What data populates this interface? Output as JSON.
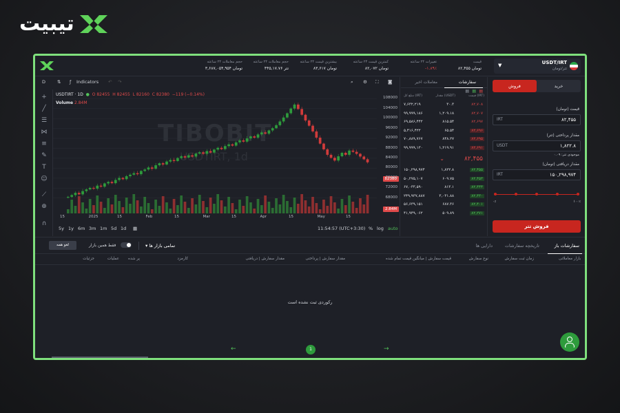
{
  "brand": {
    "name": "تیبیت"
  },
  "ticker": {
    "pair": "USDT/IRT",
    "pair_sub": "تتر/تومان",
    "stats": [
      {
        "label": "قیمت",
        "value": "۸۲,۴۵۵ تومان"
      },
      {
        "label": "تغییرات ۲۴ ساعته",
        "value": "-۱.۸۹٪"
      },
      {
        "label": "کمترین قیمت ۲۴ ساعته",
        "value": "۸۲,۰۷۲ تومان"
      },
      {
        "label": "بیشترین قیمت ۲۴ ساعته",
        "value": "۸۳,۶۱۷ تومان"
      },
      {
        "label": "حجم معاملات ۲۴ ساعته",
        "value": "۴۴۵,۱۷.۷۶ تتر"
      },
      {
        "label": "حجم معاملات ۲۴ ساعته",
        "value": "۳,۶۸۷,۰۵۴,۹۵۴ تومان"
      }
    ]
  },
  "chart": {
    "interval": "D",
    "indicators_label": "Indicators",
    "symbol_title": "USDTIRT · 1D",
    "ohlc": {
      "o": "O 82455",
      "h": "H 82455",
      "l": "L 82160",
      "c": "C 82380",
      "chg": "−119 (−0.14%)"
    },
    "volume_label": "Volume",
    "volume_value": "2.84M",
    "watermark": "TIBOBIT",
    "watermark_sub": "USDTIRT, 1d",
    "last_price_tag": "82380",
    "volume_tag": "2.84M",
    "ranges": [
      "5y",
      "1y",
      "6m",
      "3m",
      "1m",
      "5d",
      "1d"
    ],
    "clock": "11:54:57 (UTC+3:30)",
    "log_label": "log",
    "auto_label": "auto",
    "pct_label": "%"
  },
  "chart_data": {
    "type": "candlestick",
    "y_ticks": [
      108000,
      104000,
      100000,
      96000,
      92000,
      88000,
      84000,
      80000,
      76000,
      72000,
      68000
    ],
    "x_ticks": [
      "15",
      "2025",
      "15",
      "Feb",
      "15",
      "Mar",
      "15",
      "Apr",
      "15",
      "May",
      "15"
    ],
    "ylim": [
      66000,
      110000
    ],
    "closes": [
      68500,
      69200,
      70100,
      69500,
      70800,
      71500,
      72100,
      71800,
      73000,
      72600,
      73900,
      74500,
      74000,
      75300,
      76100,
      75600,
      76800,
      77400,
      78000,
      77600,
      78900,
      79500,
      80300,
      79800,
      81200,
      82000,
      81500,
      82700,
      83300,
      82900,
      84100,
      84800,
      84300,
      85200,
      84700,
      85900,
      86400,
      85800,
      86900,
      86300,
      87500,
      88200,
      87700,
      88900,
      89600,
      89100,
      90400,
      91200,
      90700,
      92000,
      92800,
      92300,
      93600,
      94400,
      93900,
      95200,
      96100,
      97300,
      98800,
      100400,
      102100,
      104000,
      105600,
      103800,
      101500,
      99200,
      97100,
      94800,
      92300,
      89900,
      87600,
      85400,
      84200,
      83100,
      84800,
      86200,
      85400,
      87100,
      86600,
      85800,
      84700,
      83600,
      82380
    ]
  },
  "orderbook": {
    "tabs": [
      "سفارشات",
      "معاملات اخیر"
    ],
    "columns": [
      "قیمت (IRT)",
      "مقدار (USDT)",
      "مبلغ کل (IRT)"
    ],
    "asks": [
      {
        "price": "۸۲,۷۰۸",
        "amount": "۳۰.۳",
        "total": "۷,۶۳۲,۲۱۹"
      },
      {
        "price": "۸۲,۷۰۷",
        "amount": "۱,۲۰۹.۱۸",
        "total": "۹۹,۹۹۹,۱۸۶"
      },
      {
        "price": "۸۲,۶۹۷",
        "amount": "۸۱۵.۵۴",
        "total": "۶۹,۵۸۶,۴۴۲"
      },
      {
        "price": "۸۲,۶۹۶",
        "amount": "۶۵.۵۴",
        "total": "۵,۴۱۶,۴۲۲"
      },
      {
        "price": "۸۲,۶۹۵",
        "amount": "۸۴۸.۲۷",
        "total": "۷۰,۸۸۹,۷۶۷"
      },
      {
        "price": "۸۲,۶۹۱",
        "amount": "۱,۲۱۹.۹۱",
        "total": "۹۹,۹۹۹,۱۳۰"
      }
    ],
    "mid_price": "۸۲,۴۵۵",
    "bids": [
      {
        "price": "۸۲,۴۵۵",
        "amount": "۱,۸۲۲.۸",
        "total": "۱۵۰,۲۹۸,۹۷۴"
      },
      {
        "price": "۸۲,۴۵۳",
        "amount": "۶۰۹.۷۵",
        "total": "۵۰,۲۷۵,۱۰۷"
      },
      {
        "price": "۸۲,۴۴۴",
        "amount": "۸۱۳.۱",
        "total": "۶۷,۰۳۳,۵۹۰"
      },
      {
        "price": "۸۲,۴۳۰",
        "amount": "۳,۰۳۱.۸۸",
        "total": "۲۴۹,۹۳۷,۸۸۷"
      },
      {
        "price": "۸۲,۴۰۱",
        "amount": "۶۸۷.۳۶",
        "total": "۵۶,۶۳۹,۱۵۱"
      },
      {
        "price": "۸۲,۲۷۱",
        "amount": "۵۰۹.۸۹",
        "total": "۴۱,۹۴۹,۰۶۲"
      }
    ]
  },
  "trade": {
    "sell_tab": "فروش",
    "buy_tab": "خرید",
    "price_label": "قیمت (تومان)",
    "price_unit": "IRT",
    "price_value": "۸۲,۴۵۵",
    "pay_label": "مقدار پرداختی (تتر)",
    "pay_unit": "USDT",
    "pay_value": "۱,۸۲۲.۸",
    "balance_note": "موجودی تتر: ۰.۰۹",
    "receive_label": "مقدار دریافتی (تومان)",
    "receive_unit": "IRT",
    "receive_value": "۱۵۰,۲۹۸,۹۷۴",
    "slider_min": "۰٪",
    "slider_max": "۱۰۰٪",
    "submit": "فروش تتر"
  },
  "orders": {
    "tabs": [
      "سفارشات باز",
      "تاریخچه سفارشات",
      "دارایی ها"
    ],
    "market_filter": "تمامی بازار ها",
    "toggle_label": "فقط همین بازار",
    "cancel_all": "لغو همه",
    "columns": [
      "بازار معاملاتی",
      "زمان ثبت سفارش",
      "نوع سفارش",
      "قیمت سفارش | میانگین قیمت تمام شده",
      "مقدار سفارش | پرداختی",
      "مقدار سفارش | دریافتی",
      "کارمزد",
      "پر شده",
      "عملیات",
      "جزئیات"
    ],
    "empty": "رکوردی ثبت نشده است",
    "page": "1"
  }
}
